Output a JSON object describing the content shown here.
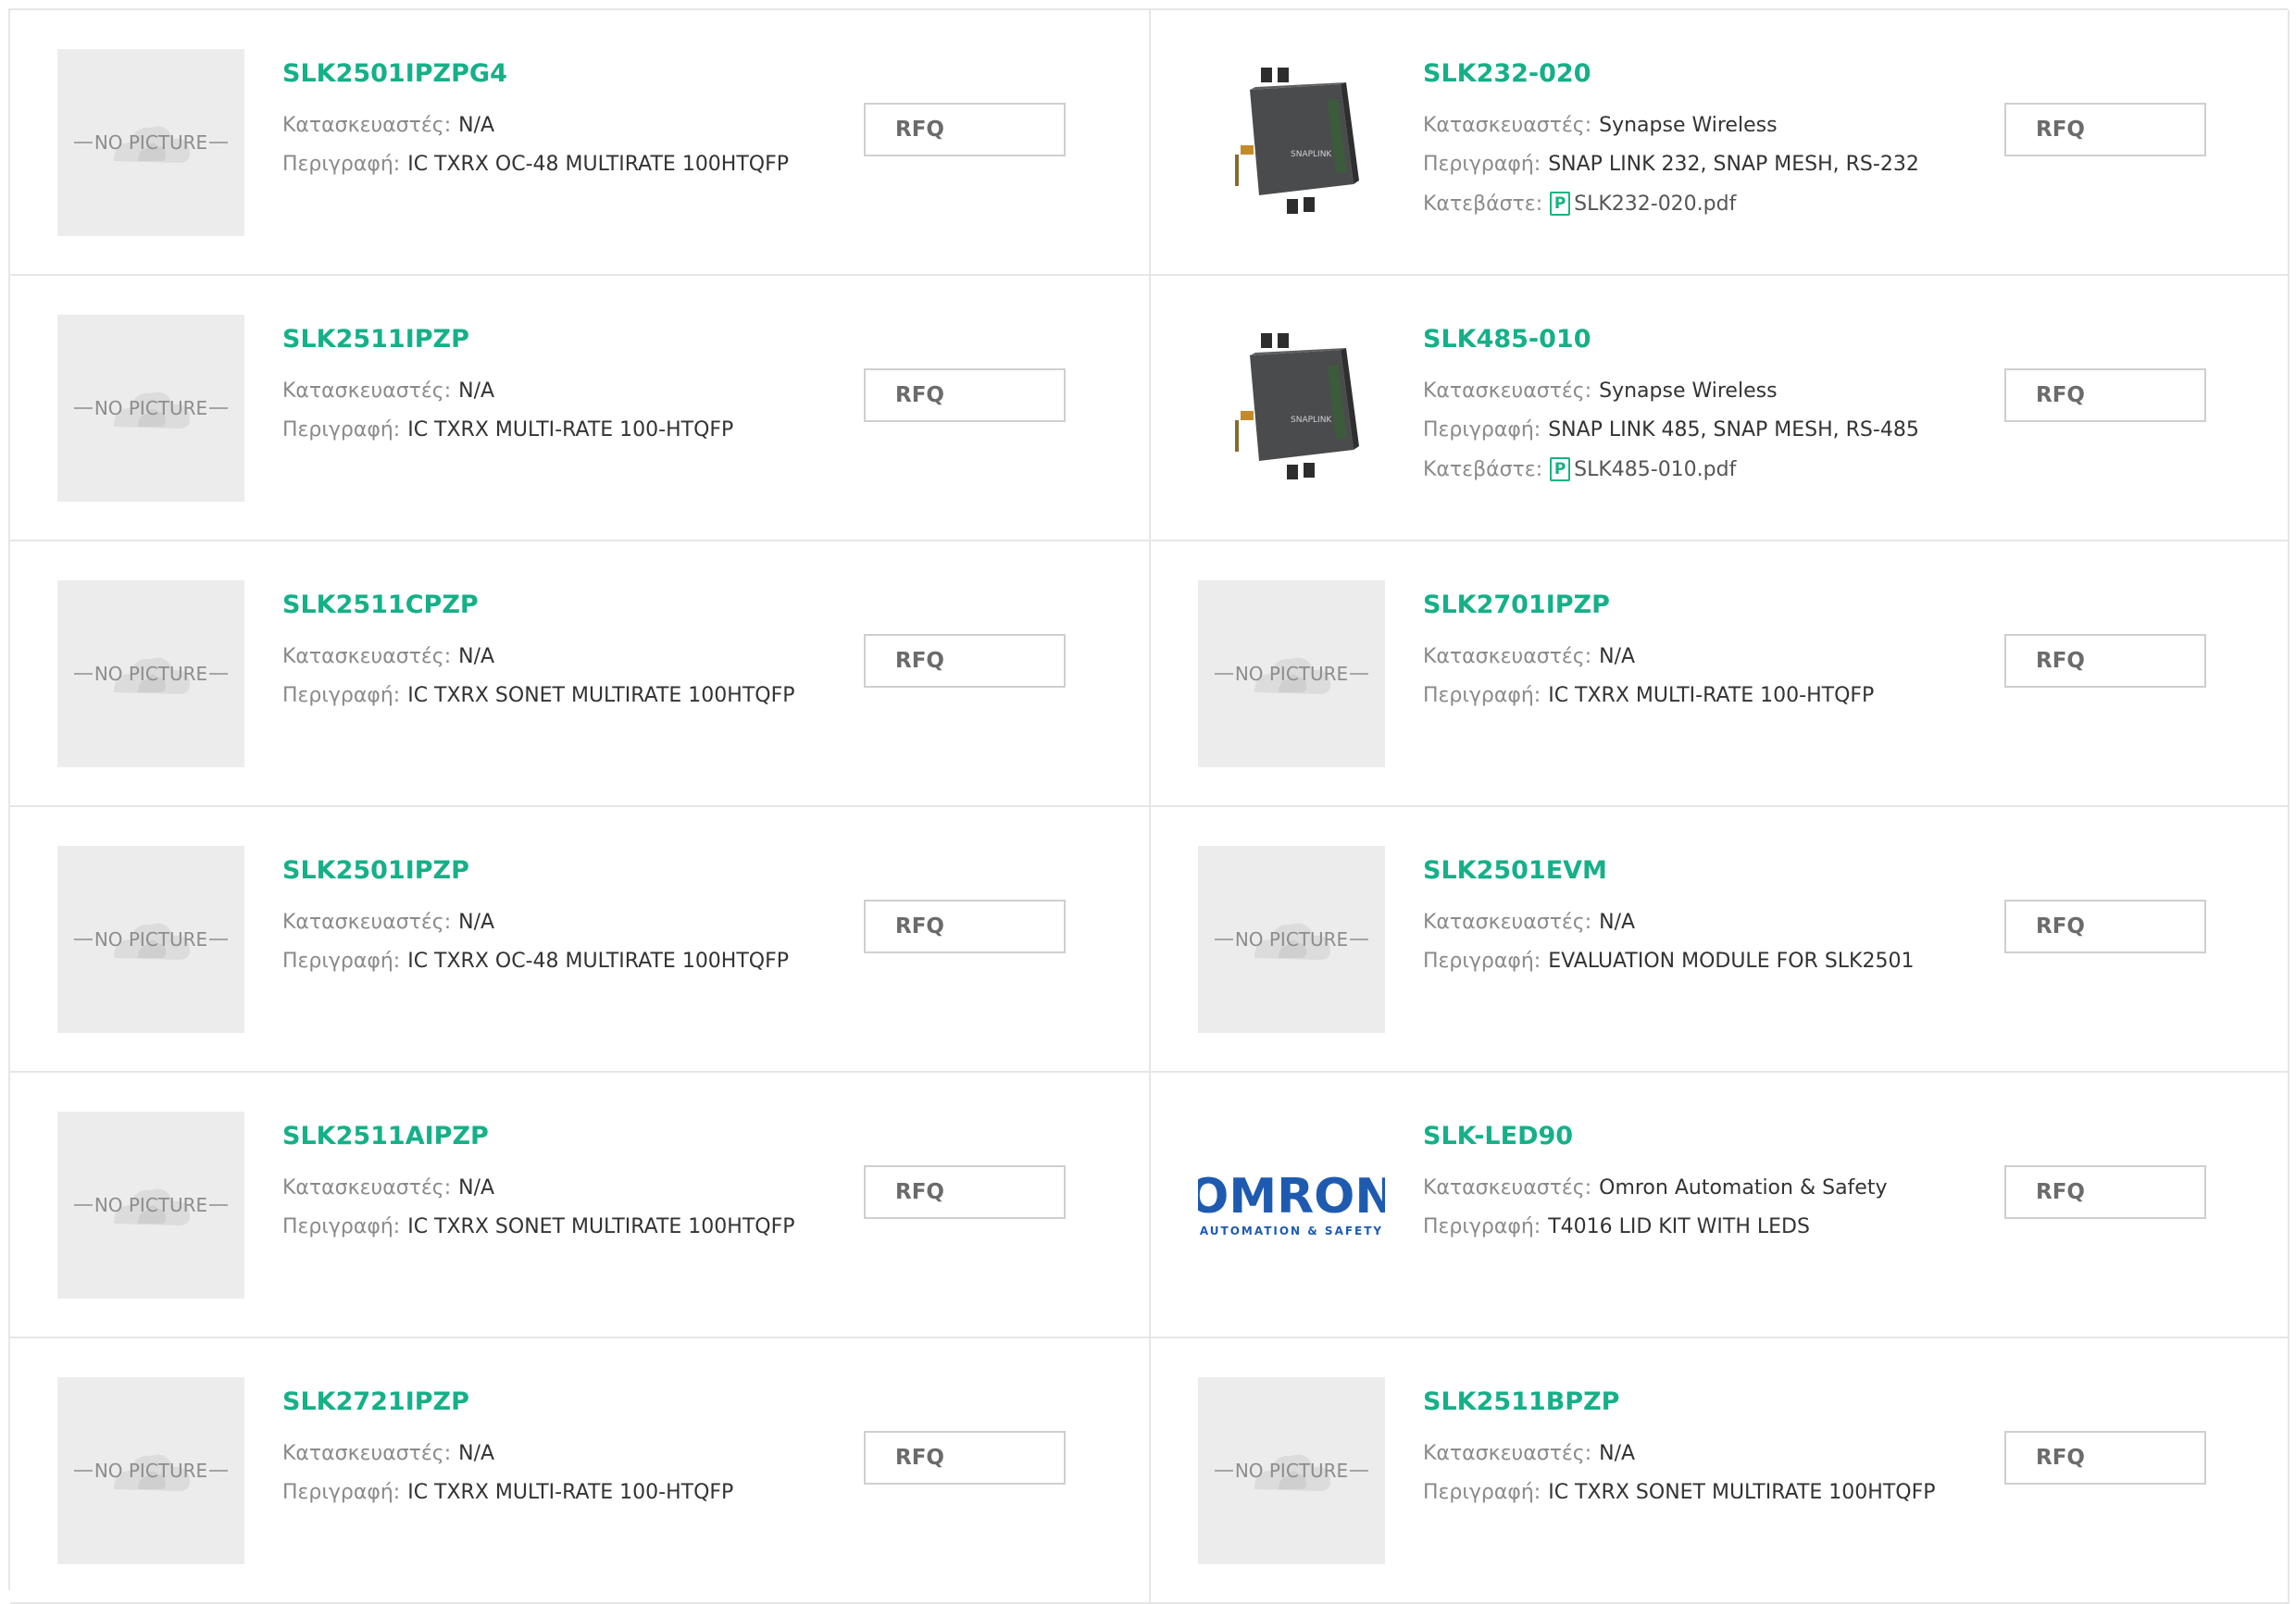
{
  "labels": {
    "manufacturer": "Κατασκευαστές:",
    "description": "Περιγραφή:",
    "download": "Κατεβάστε:",
    "no_picture": "NO PICTURE",
    "rfq": "RFQ",
    "pdf_icon": "P"
  },
  "products": [
    {
      "part": "SLK2501IPZPG4",
      "manufacturer": "N/A",
      "description": "IC TXRX OC-48 MULTIRATE 100HTQFP",
      "image": "no-picture"
    },
    {
      "part": "SLK232-020",
      "manufacturer": "Synapse Wireless",
      "description": "SNAP LINK 232, SNAP MESH, RS-232",
      "image": "device-photo",
      "pdf": "SLK232-020.pdf",
      "device_label": "SNAPLINK"
    },
    {
      "part": "SLK2511IPZP",
      "manufacturer": "N/A",
      "description": "IC TXRX MULTI-RATE 100-HTQFP",
      "image": "no-picture"
    },
    {
      "part": "SLK485-010",
      "manufacturer": "Synapse Wireless",
      "description": "SNAP LINK 485, SNAP MESH, RS-485",
      "image": "device-photo",
      "pdf": "SLK485-010.pdf",
      "device_label": "SNAPLINK"
    },
    {
      "part": "SLK2511CPZP",
      "manufacturer": "N/A",
      "description": "IC TXRX SONET MULTIRATE 100HTQFP",
      "image": "no-picture"
    },
    {
      "part": "SLK2701IPZP",
      "manufacturer": "N/A",
      "description": "IC TXRX MULTI-RATE 100-HTQFP",
      "image": "no-picture"
    },
    {
      "part": "SLK2501IPZP",
      "manufacturer": "N/A",
      "description": "IC TXRX OC-48 MULTIRATE 100HTQFP",
      "image": "no-picture"
    },
    {
      "part": "SLK2501EVM",
      "manufacturer": "N/A",
      "description": "EVALUATION MODULE FOR SLK2501",
      "image": "no-picture"
    },
    {
      "part": "SLK2511AIPZP",
      "manufacturer": "N/A",
      "description": "IC TXRX SONET MULTIRATE 100HTQFP",
      "image": "no-picture"
    },
    {
      "part": "SLK-LED90",
      "manufacturer": "Omron Automation & Safety",
      "description": "T4016 LID KIT WITH LEDS",
      "image": "omron-logo",
      "logo_text": "OMRON",
      "logo_sub": "AUTOMATION & SAFETY"
    },
    {
      "part": "SLK2721IPZP",
      "manufacturer": "N/A",
      "description": "IC TXRX MULTI-RATE 100-HTQFP",
      "image": "no-picture"
    },
    {
      "part": "SLK2511BPZP",
      "manufacturer": "N/A",
      "description": "IC TXRX SONET MULTIRATE 100HTQFP",
      "image": "no-picture"
    }
  ],
  "colors": {
    "accent": "#15b088",
    "border": "#e6e6e6",
    "label": "#8a8a8a",
    "omron_blue": "#1e5bb0"
  }
}
